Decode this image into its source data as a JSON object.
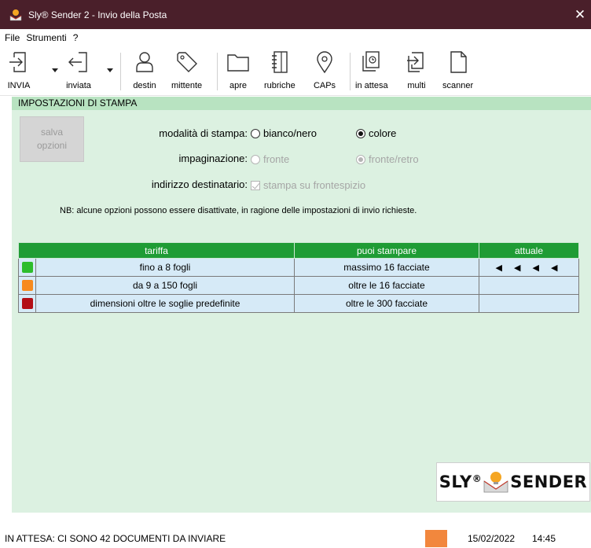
{
  "window": {
    "title": "Sly® Sender 2 - Invio della Posta",
    "close_glyph": "✕"
  },
  "menu": [
    "File",
    "Strumenti",
    "?"
  ],
  "toolbar": {
    "invia": "INVIA",
    "inviata": "inviata",
    "destin": "destin",
    "mittente": "mittente",
    "apre": "apre",
    "rubriche": "rubriche",
    "caps": "CAPs",
    "in_attesa": "in attesa",
    "multi": "multi",
    "scanner": "scanner"
  },
  "section": {
    "title": "IMPOSTAZIONI DI STAMPA",
    "salva_label": "salva opzioni"
  },
  "options": {
    "modalita_label": "modalità di stampa:",
    "modalita_bn": "bianco/nero",
    "modalita_colore": "colore",
    "modalita_selected": "colore",
    "impaginazione_label": "impaginazione:",
    "impaginazione_fronte": "fronte",
    "impaginazione_fronte_retro": "fronte/retro",
    "impaginazione_selected": "fronte/retro",
    "destinatario_label": "indirizzo destinatario:",
    "destinatario_check": "stampa su frontespizio",
    "destinatario_checked": true
  },
  "note": "NB: alcune opzioni possono essere disattivate, in ragione delle impostazioni di invio richieste.",
  "table": {
    "headers": [
      "tariffa",
      "puoi stampare",
      "attuale"
    ],
    "rows": [
      {
        "color": "#2dbd2d",
        "tariffa": "fino a 8 fogli",
        "stampare": "massimo 16 facciate",
        "attuale": "◀ ◀ ◀ ◀"
      },
      {
        "color": "#f78a1e",
        "tariffa": "da 9 a 150 fogli",
        "stampare": "oltre le 16 facciate",
        "attuale": ""
      },
      {
        "color": "#b30f16",
        "tariffa": "dimensioni oltre le soglie predefinite",
        "stampare": "oltre le 300 facciate",
        "attuale": ""
      }
    ]
  },
  "logo": {
    "left": "SLY",
    "reg": "®",
    "right": "SENDER"
  },
  "status": {
    "message": "IN ATTESA: CI SONO 42 DOCUMENTI DA INVIARE",
    "indicator_color": "#f2873d",
    "date": "15/02/2022",
    "time": "14:45"
  },
  "colors": {
    "titlebar": "#4a1f2a",
    "header_green": "#1f9c35",
    "panel": "#dcf1e1",
    "section_header": "#b8e3c1",
    "row_bg": "#d6eaf7"
  }
}
